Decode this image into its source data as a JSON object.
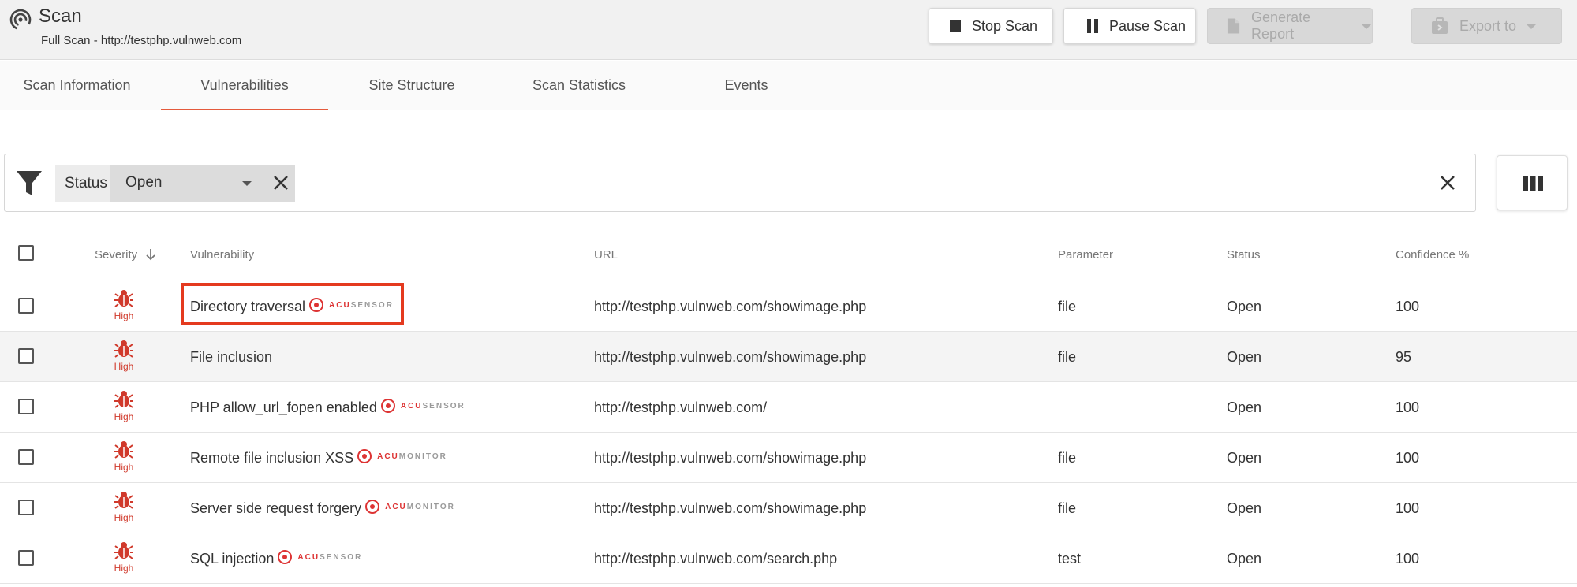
{
  "header": {
    "title": "Scan",
    "subtitle": "Full Scan - http://testphp.vulnweb.com",
    "buttons": {
      "stop": "Stop Scan",
      "pause": "Pause Scan",
      "report": "Generate Report",
      "export": "Export to"
    }
  },
  "tabs": [
    {
      "label": "Scan Information"
    },
    {
      "label": "Vulnerabilities"
    },
    {
      "label": "Site Structure"
    },
    {
      "label": "Scan Statistics"
    },
    {
      "label": "Events"
    }
  ],
  "filter": {
    "field": "Status",
    "value": "Open"
  },
  "table": {
    "headers": {
      "severity": "Severity",
      "vulnerability": "Vulnerability",
      "url": "URL",
      "parameter": "Parameter",
      "status": "Status",
      "confidence": "Confidence %"
    },
    "rows": [
      {
        "severity": "High",
        "name": "Directory traversal",
        "badge_a": "ACU",
        "badge_b": "SENSOR",
        "url": "http://testphp.vulnweb.com/showimage.php",
        "parameter": "file",
        "status": "Open",
        "confidence": "100"
      },
      {
        "severity": "High",
        "name": "File inclusion",
        "badge_a": "",
        "badge_b": "",
        "url": "http://testphp.vulnweb.com/showimage.php",
        "parameter": "file",
        "status": "Open",
        "confidence": "95"
      },
      {
        "severity": "High",
        "name": "PHP allow_url_fopen enabled",
        "badge_a": "ACU",
        "badge_b": "SENSOR",
        "url": "http://testphp.vulnweb.com/",
        "parameter": "",
        "status": "Open",
        "confidence": "100"
      },
      {
        "severity": "High",
        "name": "Remote file inclusion XSS",
        "badge_a": "ACU",
        "badge_b": "MONITOR",
        "url": "http://testphp.vulnweb.com/showimage.php",
        "parameter": "file",
        "status": "Open",
        "confidence": "100"
      },
      {
        "severity": "High",
        "name": "Server side request forgery",
        "badge_a": "ACU",
        "badge_b": "MONITOR",
        "url": "http://testphp.vulnweb.com/showimage.php",
        "parameter": "file",
        "status": "Open",
        "confidence": "100"
      },
      {
        "severity": "High",
        "name": "SQL injection",
        "badge_a": "ACU",
        "badge_b": "SENSOR",
        "url": "http://testphp.vulnweb.com/search.php",
        "parameter": "test",
        "status": "Open",
        "confidence": "100"
      }
    ]
  },
  "colors": {
    "accent": "#e45a3c",
    "severity_high": "#d0392b",
    "highlight": "#e43a1f"
  }
}
